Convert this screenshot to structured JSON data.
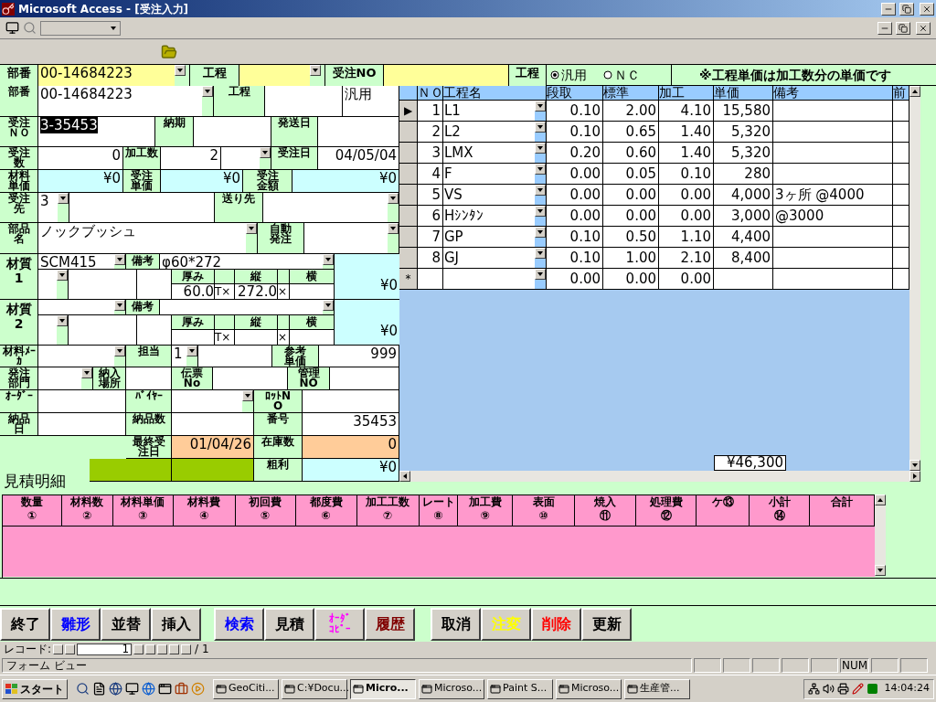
{
  "window": {
    "title": "Microsoft Access - [受注入力]"
  },
  "header": {
    "cells": [
      {
        "kind": "label",
        "text": "部番"
      },
      {
        "kind": "ycombo",
        "text": "00-14684223"
      },
      {
        "kind": "label",
        "text": "工程"
      },
      {
        "kind": "ycombo"
      },
      {
        "kind": "label",
        "text": "受注NO"
      },
      {
        "kind": "yellow"
      },
      {
        "kind": "label",
        "text": "工程"
      }
    ],
    "radios": [
      {
        "label": "汎用",
        "selected": true
      },
      {
        "label": "ＮＣ",
        "selected": false
      }
    ],
    "note": "※工程単価は加工数分の単価です"
  },
  "form": {
    "lines": [
      {
        "fields": [
          {
            "kind": "label",
            "text": "部番"
          },
          {
            "kind": "combo",
            "text": "00-14684223"
          },
          {
            "kind": "label",
            "text": "工程"
          },
          {
            "kind": "text"
          },
          {
            "kind": "text",
            "text": "汎用"
          }
        ]
      },
      {
        "fields": [
          {
            "kind": "label",
            "text": "受注ＮＯ"
          },
          {
            "kind": "selected",
            "text": "3-35453"
          },
          {
            "kind": "label",
            "text": "納期"
          },
          {
            "kind": "text"
          },
          {
            "kind": "label",
            "text": "発送日"
          },
          {
            "kind": "text"
          }
        ]
      },
      {
        "fields": [
          {
            "kind": "label",
            "text": "受注数"
          },
          {
            "kind": "num",
            "text": "0"
          },
          {
            "kind": "label",
            "text": "加工数"
          },
          {
            "kind": "num",
            "text": "2"
          },
          {
            "kind": "combo"
          },
          {
            "kind": "label",
            "text": "受注日"
          },
          {
            "kind": "num",
            "text": "04/05/04"
          }
        ]
      },
      {
        "fields": [
          {
            "kind": "label",
            "text": "材料単価"
          },
          {
            "kind": "money",
            "text": "¥0"
          },
          {
            "kind": "label",
            "text": "受注単価"
          },
          {
            "kind": "money",
            "text": "¥0"
          },
          {
            "kind": "label",
            "text": "受注金額"
          },
          {
            "kind": "money",
            "text": "¥0"
          }
        ]
      },
      {
        "fields": [
          {
            "kind": "label",
            "text": "受注先"
          },
          {
            "kind": "combo",
            "text": "3"
          },
          {
            "kind": "text"
          },
          {
            "kind": "label",
            "text": "送り先"
          },
          {
            "kind": "combo"
          }
        ]
      },
      {
        "fields": [
          {
            "kind": "label",
            "text": "部品名"
          },
          {
            "kind": "combo",
            "text": "ノックブッシュ"
          },
          {
            "kind": "label",
            "text": "自動発注"
          },
          {
            "kind": "combo"
          }
        ]
      }
    ],
    "materials": [
      {
        "label": "材質1",
        "material": "SCM415",
        "note_label": "備考",
        "note": "φ60*272",
        "dims": [
          {
            "label": "厚み",
            "value": "60.0",
            "unit": "T×"
          },
          {
            "label": "縦",
            "value": "272.0",
            "unit": "×"
          },
          {
            "label": "横"
          }
        ],
        "price": "¥0"
      },
      {
        "label": "材質2",
        "note_label": "備考",
        "dims": [
          {
            "label": "厚み",
            "unit": "T×"
          },
          {
            "label": "縦",
            "unit": "×"
          },
          {
            "label": "横"
          }
        ],
        "price": "¥0"
      }
    ],
    "lines2": [
      {
        "fields": [
          {
            "kind": "label",
            "text": "材料ﾒｰｶ"
          },
          {
            "kind": "combo"
          },
          {
            "kind": "label",
            "text": "担当"
          },
          {
            "kind": "combo",
            "text": "1"
          },
          {
            "kind": "text"
          },
          {
            "kind": "label",
            "text": "参考単価"
          },
          {
            "kind": "num",
            "text": "999"
          }
        ]
      },
      {
        "fields": [
          {
            "kind": "label",
            "text": "発注部門"
          },
          {
            "kind": "combo"
          },
          {
            "kind": "label",
            "text": "納入場所"
          },
          {
            "kind": "text"
          },
          {
            "kind": "label",
            "text": "伝票No"
          },
          {
            "kind": "text"
          },
          {
            "kind": "label",
            "text": "管理NO"
          },
          {
            "kind": "text"
          }
        ]
      },
      {
        "fields": [
          {
            "kind": "label",
            "text": "ｵｰﾀﾞｰ"
          },
          {
            "kind": "text"
          },
          {
            "kind": "label",
            "text": "ﾊﾞｲﾔｰ"
          },
          {
            "kind": "combo"
          },
          {
            "kind": "label",
            "text": "ﾛｯﾄNO"
          },
          {
            "kind": "text"
          }
        ]
      },
      {
        "fields": [
          {
            "kind": "label",
            "text": "納品日"
          },
          {
            "kind": "text"
          },
          {
            "kind": "label",
            "text": "納品数"
          },
          {
            "kind": "text"
          },
          {
            "kind": "label",
            "text": "番号"
          },
          {
            "kind": "num",
            "text": "35453"
          }
        ]
      },
      {
        "fields": [
          {
            "kind": "blank"
          },
          {
            "kind": "label",
            "text": "最終受注日"
          },
          {
            "kind": "peach",
            "text": "01/04/26"
          },
          {
            "kind": "label",
            "text": "在庫数"
          },
          {
            "kind": "peach",
            "text": "0"
          }
        ]
      },
      {
        "fields": [
          {
            "kind": "title",
            "text": "見積明細"
          },
          {
            "kind": "olive"
          },
          {
            "kind": "olive"
          },
          {
            "kind": "label",
            "text": "粗利"
          },
          {
            "kind": "money",
            "text": "¥0"
          }
        ]
      }
    ]
  },
  "process_grid": {
    "columns": [
      "ＮＯ",
      "工程名",
      "段取",
      "標準",
      "加工",
      "単価",
      "備考",
      "前"
    ],
    "rows": [
      {
        "marker": "▶",
        "no": "1",
        "name": "L1",
        "setup": "0.10",
        "standard": "2.00",
        "machining": "4.10",
        "price": "15,580"
      },
      {
        "no": "2",
        "name": "L2",
        "setup": "0.10",
        "standard": "0.65",
        "machining": "1.40",
        "price": "5,320"
      },
      {
        "no": "3",
        "name": "LMX",
        "setup": "0.20",
        "standard": "0.60",
        "machining": "1.40",
        "price": "5,320"
      },
      {
        "no": "4",
        "name": "F",
        "setup": "0.00",
        "standard": "0.05",
        "machining": "0.10",
        "price": "280"
      },
      {
        "no": "5",
        "name": "VS",
        "setup": "0.00",
        "standard": "0.00",
        "machining": "0.00",
        "price": "4,000",
        "remarks": "3ヶ所 @4000"
      },
      {
        "no": "6",
        "name": "Hｼﾝﾀﾝ",
        "setup": "0.00",
        "standard": "0.00",
        "machining": "0.00",
        "price": "3,000",
        "remarks": "@3000"
      },
      {
        "no": "7",
        "name": "GP",
        "setup": "0.10",
        "standard": "0.50",
        "machining": "1.10",
        "price": "4,400"
      },
      {
        "no": "8",
        "name": "GJ",
        "setup": "0.10",
        "standard": "1.00",
        "machining": "2.10",
        "price": "8,400"
      },
      {
        "marker": "*",
        "setup": "0.00",
        "standard": "0.00",
        "machining": "0.00"
      }
    ],
    "total": "¥46,300"
  },
  "estimate_grid": {
    "columns": [
      "数量①",
      "材料数②",
      "材料単価③",
      "材料費④",
      "初回費⑤",
      "都度費⑥",
      "加工工数⑦",
      "レート⑧",
      "加工費⑨",
      "表面⑩",
      "焼入⑪",
      "処理費⑫",
      "ケ⑬",
      "小計⑭",
      "合計"
    ]
  },
  "buttons": [
    [
      {
        "label": "終了",
        "color": "#000000"
      },
      {
        "label": "雛形",
        "color": "#0000ff"
      },
      {
        "label": "並替",
        "color": "#000000"
      },
      {
        "label": "挿入",
        "color": "#000000"
      }
    ],
    [
      {
        "label": "検索",
        "color": "#0000ff"
      },
      {
        "label": "見積",
        "color": "#000000"
      },
      {
        "label": "ｵｰﾀﾞｺﾋﾟｰ",
        "color": "#ff00ff"
      },
      {
        "label": "履歴",
        "color": "#800000"
      }
    ],
    [
      {
        "label": "取消",
        "color": "#000000"
      },
      {
        "label": "注変",
        "color": "#ffff00"
      },
      {
        "label": "削除",
        "color": "#ff0000"
      },
      {
        "label": "更新",
        "color": "#000000"
      }
    ]
  ],
  "record_nav": {
    "label": "レコード:",
    "current": "1",
    "total": "/ 1"
  },
  "status_bar": {
    "text": "フォーム ビュー",
    "indicator": "NUM"
  },
  "taskbar": {
    "start": "スタート",
    "tasks": [
      {
        "label": "GeoCiti...",
        "selected": false
      },
      {
        "label": "C:¥Docu...",
        "selected": false
      },
      {
        "label": "Micro...",
        "selected": true
      },
      {
        "label": "Microso...",
        "selected": false
      },
      {
        "label": "Paint S...",
        "selected": false
      },
      {
        "label": "Microso...",
        "selected": false
      },
      {
        "label": "生産管...",
        "selected": false
      }
    ],
    "clock": "14:04:24"
  }
}
